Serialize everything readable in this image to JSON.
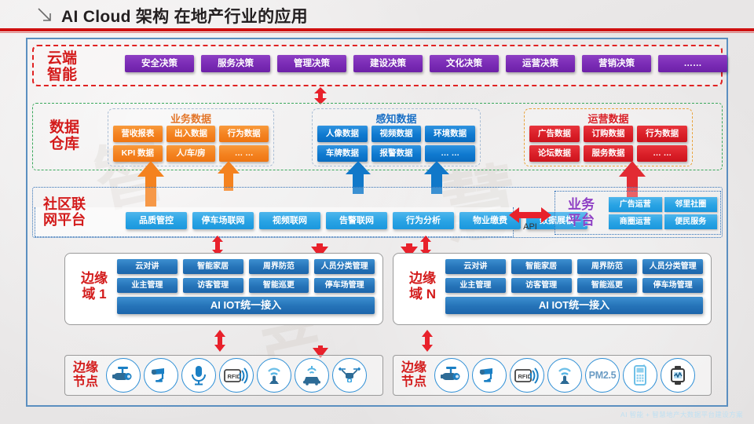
{
  "header": {
    "title": "AI Cloud 架构 在地产行业的应用",
    "mark_icon": "diagonal-arrow-icon"
  },
  "cloud": {
    "label": "云端\n智能",
    "buttons": [
      "安全决策",
      "服务决策",
      "管理决策",
      "建设决策",
      "文化决策",
      "运营决策",
      "营销决策",
      "……"
    ]
  },
  "data_warehouse": {
    "label": "数据\n仓库",
    "groups": [
      {
        "title": "业务数据",
        "color": "#f4821f",
        "rows": [
          [
            "营收报表",
            "出入数据",
            "行为数据"
          ],
          [
            "KPI 数据",
            "人/车/房",
            "… …"
          ]
        ]
      },
      {
        "title": "感知数据",
        "color": "#0f7ad0",
        "rows": [
          [
            "人像数据",
            "视频数据",
            "环境数据"
          ],
          [
            "车牌数据",
            "报警数据",
            "… …"
          ]
        ]
      },
      {
        "title": "运营数据",
        "color": "#da1f28",
        "rows": [
          [
            "广告数据",
            "订购数据",
            "行为数据"
          ],
          [
            "论坛数据",
            "服务数据",
            "… …"
          ]
        ]
      }
    ]
  },
  "community_platform": {
    "label": "社区联\n网平台",
    "buttons": [
      "品质管控",
      "停车场联网",
      "视频联网",
      "告警联网",
      "行为分析",
      "物业缴费",
      "数据展板"
    ]
  },
  "api": {
    "label": "API",
    "icon": "double-arrow-horizontal-icon"
  },
  "business_platform": {
    "label": "业务\n平台",
    "cells": [
      "广告运营",
      "邻里社圈",
      "商圈运营",
      "便民服务"
    ]
  },
  "edge_domains": [
    {
      "label": "边缘\n域 1",
      "rows": [
        [
          "云对讲",
          "智能家居",
          "周界防范",
          "人员分类管理"
        ],
        [
          "业主管理",
          "访客管理",
          "智能巡更",
          "停车场管理"
        ]
      ],
      "bar": "AI IOT统一接入"
    },
    {
      "label": "边缘\n域 N",
      "rows": [
        [
          "云对讲",
          "智能家居",
          "周界防范",
          "人员分类管理"
        ],
        [
          "业主管理",
          "访客管理",
          "智能巡更",
          "停车场管理"
        ]
      ],
      "bar": "AI IOT统一接入"
    }
  ],
  "edge_nodes": [
    {
      "label": "边缘\n节点",
      "icons": [
        "bullet-camera-icon",
        "dome-camera-icon",
        "microphone-icon",
        "rfid-icon",
        "wifi-sensor-icon",
        "vehicle-sensor-icon",
        "drone-camera-icon"
      ]
    },
    {
      "label": "边缘\n节点",
      "icons": [
        "bullet-camera-icon",
        "dome-camera-icon",
        "rfid-icon",
        "wifi-sensor-icon",
        "pm25-icon",
        "intercom-phone-icon",
        "smart-monitor-icon"
      ]
    }
  ],
  "labels": {
    "rfid": "RFID",
    "pm25": "PM2.5"
  },
  "footer": {
    "text": "AI 智能 + 智慧地产大数据平台建设方案"
  },
  "colors": {
    "accent_red": "#cf1010",
    "purple": "#7a2bb5",
    "orange": "#f4821f",
    "blue": "#0f7ad0",
    "red": "#da1f28",
    "light_blue": "#28a3e4",
    "frame_blue": "#5b8fc0"
  }
}
